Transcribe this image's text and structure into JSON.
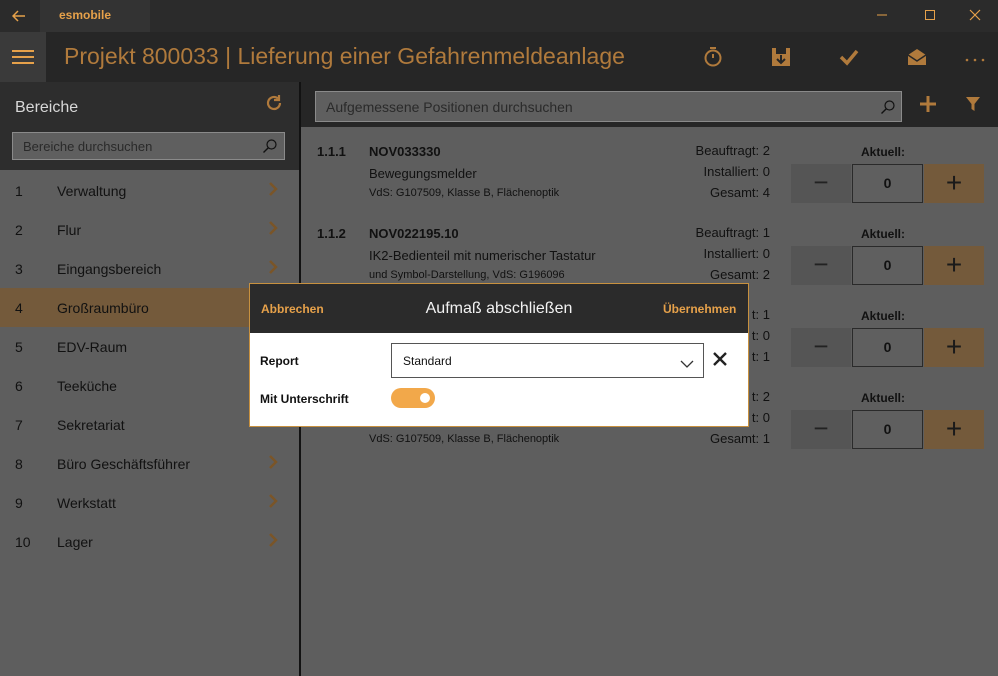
{
  "window": {
    "app_name": "esmobile",
    "back_icon": "arrow-left-icon",
    "minimize_icon": "minimize-icon",
    "maximize_icon": "maximize-icon",
    "close_icon": "close-icon"
  },
  "header": {
    "title": "Projekt 800033  |  Lieferung einer Gefahrenmeldeanlage",
    "menu_icon": "hamburger-icon",
    "actions": [
      "timer-icon",
      "save-floppy-icon",
      "checkmark-icon",
      "mail-open-icon",
      "more-icon"
    ]
  },
  "sidebar": {
    "title": "Bereiche",
    "refresh_icon": "refresh-icon",
    "search_placeholder": "Bereiche durchsuchen",
    "items": [
      {
        "num": "1",
        "label": "Verwaltung",
        "active": false
      },
      {
        "num": "2",
        "label": "Flur",
        "active": false
      },
      {
        "num": "3",
        "label": "Eingangsbereich",
        "active": false
      },
      {
        "num": "4",
        "label": "Großraumbüro",
        "active": true
      },
      {
        "num": "5",
        "label": "EDV-Raum",
        "active": false
      },
      {
        "num": "6",
        "label": "Teeküche",
        "active": false
      },
      {
        "num": "7",
        "label": "Sekretariat",
        "active": false
      },
      {
        "num": "8",
        "label": "Büro Geschäftsführer",
        "active": false
      },
      {
        "num": "9",
        "label": "Werkstatt",
        "active": false
      },
      {
        "num": "10",
        "label": "Lager",
        "active": false
      }
    ]
  },
  "main": {
    "search_placeholder": "Aufgemessene Positionen durchsuchen",
    "add_icon": "plus-icon",
    "filter_icon": "filter-icon",
    "positions": [
      {
        "idx": "1.1.1",
        "code": "NOV033330",
        "name": "Bewegungsmelder",
        "sub": "VdS: G107509, Klasse B, Flächenoptik",
        "beauftragt": "Beauftragt: 2",
        "installiert": "Installiert: 0",
        "gesamt": "Gesamt: 4",
        "aktuell_label": "Aktuell:",
        "qty": "0",
        "minus": "−",
        "plus": "+"
      },
      {
        "idx": "1.1.2",
        "code": "NOV022195.10",
        "name": "IK2-Bedienteil mit numerischer Tastatur",
        "sub": "und Symbol-Darstellung, VdS: G196096",
        "beauftragt": "Beauftragt: 1",
        "installiert": "Installiert: 0",
        "gesamt": "Gesamt: 2",
        "aktuell_label": "Aktuell:",
        "qty": "0",
        "minus": "−",
        "plus": "+"
      },
      {
        "idx": "",
        "code": "",
        "name": "",
        "sub": "",
        "beauftragt": "t: 1",
        "installiert": "t: 0",
        "gesamt": "t: 1",
        "aktuell_label": "Aktuell:",
        "qty": "0",
        "minus": "−",
        "plus": "+"
      },
      {
        "idx": "",
        "code": "",
        "name": "",
        "sub": "VdS: G107509, Klasse B, Flächenoptik",
        "beauftragt": "t: 2",
        "installiert": "t: 0",
        "gesamt": "Gesamt: 1",
        "aktuell_label": "Aktuell:",
        "qty": "0",
        "minus": "−",
        "plus": "+"
      }
    ]
  },
  "dialog": {
    "cancel": "Abbrechen",
    "title": "Aufmaß abschließen",
    "apply": "Übernehmen",
    "report_label": "Report",
    "report_value": "Standard",
    "signature_label": "Mit Unterschrift",
    "signature_on": true,
    "accent": "#f2a84a"
  }
}
